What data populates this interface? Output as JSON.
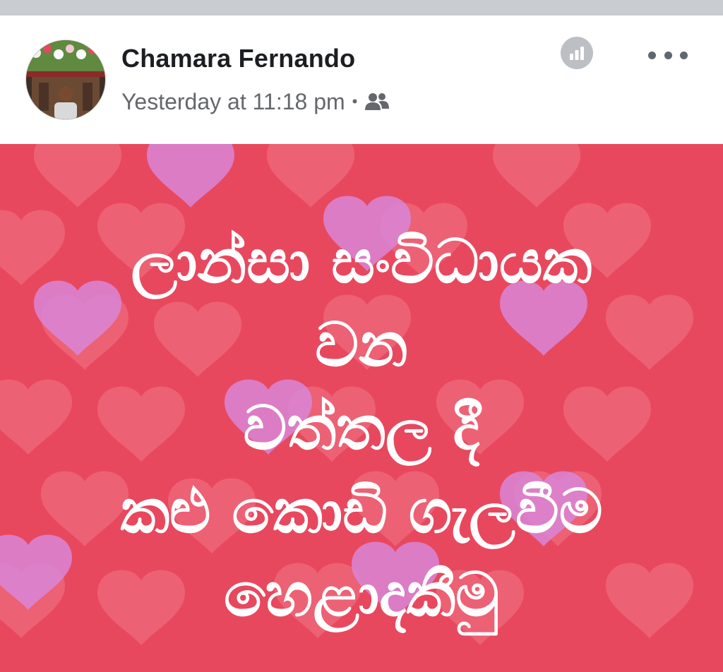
{
  "post": {
    "author": "Chamara Fernando",
    "timestamp": "Yesterday at 11:18 pm",
    "separator": "•",
    "audience_icon": "friends-icon",
    "insights_icon": "insights-icon",
    "menu_icon": "more-options-icon",
    "background_color": "#e8485e",
    "text_color": "#ffffff",
    "lines": [
      "ලාන්සා සංවිධායක",
      "වන",
      "වත්තල දී",
      "කළු කොඩි ගැලවීම",
      "හෙළාදකීමු"
    ]
  }
}
